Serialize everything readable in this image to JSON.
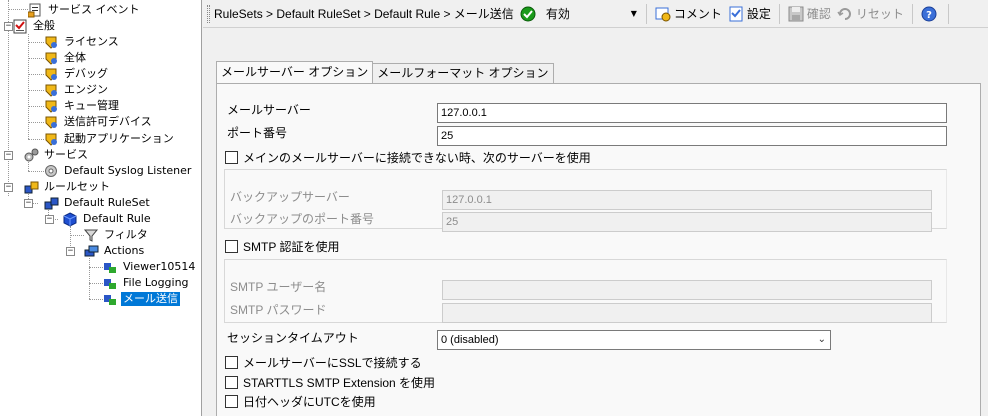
{
  "tree": {
    "items": [
      {
        "label": "サービス イベント",
        "icon": "service-event-icon"
      },
      {
        "label": "全般",
        "icon": "general-checklist-icon"
      },
      {
        "label": "ライセンス",
        "icon": "shield-icon"
      },
      {
        "label": "全体",
        "icon": "shield-icon"
      },
      {
        "label": "デバッグ",
        "icon": "shield-icon"
      },
      {
        "label": "エンジン",
        "icon": "shield-icon"
      },
      {
        "label": "キュー管理",
        "icon": "shield-icon"
      },
      {
        "label": "送信許可デバイス",
        "icon": "shield-icon"
      },
      {
        "label": "起動アプリケーション",
        "icon": "shield-icon"
      },
      {
        "label": "サービス",
        "icon": "gears-icon"
      },
      {
        "label": "Default Syslog Listener",
        "icon": "gear-icon"
      },
      {
        "label": "ルールセット",
        "icon": "ruleset-icon"
      },
      {
        "label": "Default RuleSet",
        "icon": "ruleset-icon"
      },
      {
        "label": "Default Rule",
        "icon": "rule-cube-icon"
      },
      {
        "label": "フィルタ",
        "icon": "filter-icon"
      },
      {
        "label": "Actions",
        "icon": "actions-icon"
      },
      {
        "label": "Viewer10514",
        "icon": "action-item-icon"
      },
      {
        "label": "File Logging",
        "icon": "action-item-icon"
      },
      {
        "label": "メール送信",
        "icon": "action-item-icon"
      }
    ],
    "selected": "メール送信"
  },
  "toolbar": {
    "breadcrumb": "RuleSets > Default RuleSet > Default Rule > メール送信",
    "status_value": "有効",
    "comment_label": "コメント",
    "settings_label": "設定",
    "confirm_label": "確認",
    "reset_label": "リセット"
  },
  "tabs": [
    {
      "label": "メールサーバー オプション",
      "active": true
    },
    {
      "label": "メールフォーマット オプション",
      "active": false
    }
  ],
  "form": {
    "mail_server_label": "メールサーバー",
    "mail_server_value": "127.0.0.1",
    "port_label": "ポート番号",
    "port_value": "25",
    "backup_checkbox_label": "メインのメールサーバーに接続できない時、次のサーバーを使用",
    "backup_checked": false,
    "backup_server_label": "バックアップサーバー",
    "backup_server_value": "127.0.0.1",
    "backup_port_label": "バックアップのポート番号",
    "backup_port_value": "25",
    "smtp_auth_label": "SMTP 認証を使用",
    "smtp_auth_checked": false,
    "smtp_user_label": "SMTP ユーザー名",
    "smtp_user_value": "",
    "smtp_password_label": "SMTP パスワード",
    "smtp_password_value": "",
    "session_timeout_label": "セッションタイムアウト",
    "session_timeout_value": "0 (disabled)",
    "ssl_label": "メールサーバーにSSLで接続する",
    "ssl_checked": false,
    "starttls_label": "STARTTLS SMTP Extension を使用",
    "starttls_checked": false,
    "utc_label": "日付ヘッダにUTCを使用",
    "utc_checked": false
  },
  "colors": {
    "selection": "#0078d7",
    "status_green": "#1a9b1a",
    "help_blue": "#3a6fd8",
    "disabled_text": "#8d8d8d"
  }
}
